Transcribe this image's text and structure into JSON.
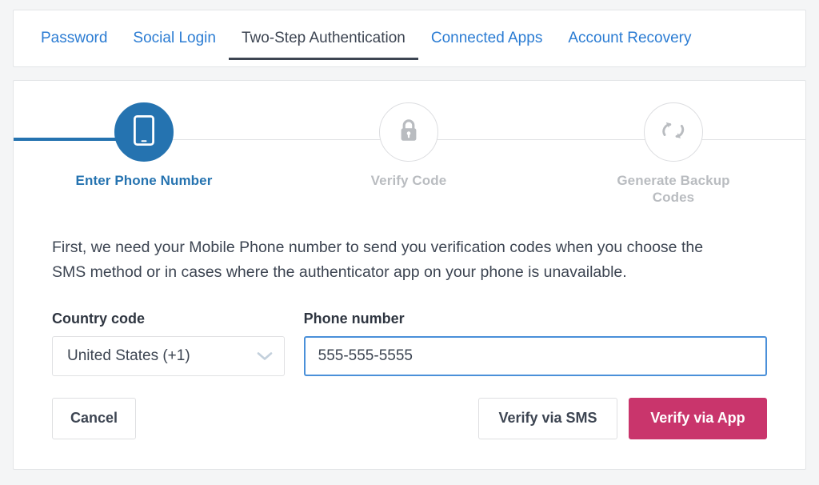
{
  "tabs": [
    {
      "label": "Password",
      "active": false
    },
    {
      "label": "Social Login",
      "active": false
    },
    {
      "label": "Two-Step Authentication",
      "active": true
    },
    {
      "label": "Connected Apps",
      "active": false
    },
    {
      "label": "Account Recovery",
      "active": false
    }
  ],
  "stepper": {
    "progress_percent": 15,
    "steps": [
      {
        "label": "Enter Phone Number",
        "icon": "mobile-phone-icon",
        "state": "active"
      },
      {
        "label": "Verify Code",
        "icon": "lock-icon",
        "state": "upcoming"
      },
      {
        "label": "Generate Backup Codes",
        "icon": "sync-arrows-icon",
        "state": "upcoming"
      }
    ]
  },
  "main": {
    "description": "First, we need your Mobile Phone number to send you verification codes when you choose the SMS method or in cases where the authenticator app on your phone is unavailable.",
    "country_code": {
      "label": "Country code",
      "value": "United States (+1)",
      "icon": "chevron-down-icon"
    },
    "phone_number": {
      "label": "Phone number",
      "value": "555-555-5555",
      "placeholder": "Phone number",
      "focused": true
    },
    "buttons": {
      "cancel": "Cancel",
      "verify_sms": "Verify via SMS",
      "verify_app": "Verify via App"
    }
  },
  "colors": {
    "accent_blue": "#2573b0",
    "link_blue": "#2b7cd3",
    "focus_blue": "#4a90d9",
    "primary_pink": "#c9356c",
    "text_dark": "#3d4552",
    "muted_gray": "#b9bcc0",
    "page_bg": "#f4f5f6"
  }
}
